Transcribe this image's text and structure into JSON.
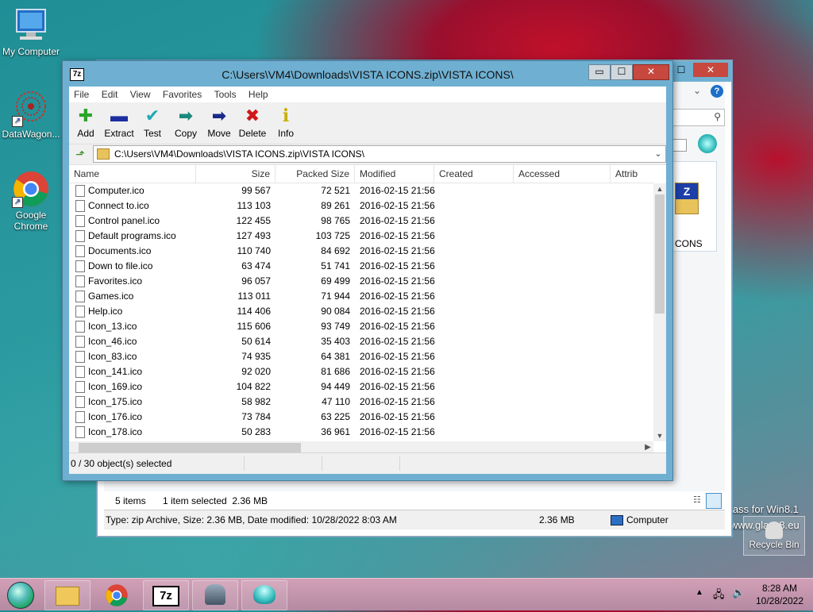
{
  "desktop": {
    "icons": [
      {
        "label": "My Computer"
      },
      {
        "label": "DataWagon..."
      },
      {
        "label": "Google Chrome"
      }
    ],
    "recycle_bin": "Recycle Bin",
    "watermark_line1": "lass for Win8.1",
    "watermark_line2": "www.glass8.eu"
  },
  "explorer": {
    "status_items": "5 items",
    "status_selected": "1 item selected  2.36 MB",
    "detail": "Type: zip Archive, Size: 2.36 MB, Date modified: 10/28/2022 8:03 AM",
    "detail_size": "2.36 MB",
    "detail_location": "Computer",
    "partial_icon_label": "CONS",
    "search_placeholder": "",
    "buttons": {
      "minimize": "—",
      "maximize": "☐",
      "close": "✕",
      "help": "?"
    }
  },
  "zip": {
    "title": "C:\\Users\\VM4\\Downloads\\VISTA ICONS.zip\\VISTA ICONS\\",
    "app_icon": "7z",
    "window_buttons": {
      "minimize": "▭",
      "maximize": "☐",
      "close": "✕"
    },
    "menu": [
      "File",
      "Edit",
      "View",
      "Favorites",
      "Tools",
      "Help"
    ],
    "toolbar": [
      {
        "label": "Add",
        "icon": "plus-icon",
        "glyph": "✚",
        "color": "#2aa52a"
      },
      {
        "label": "Extract",
        "icon": "minus-icon",
        "glyph": "▬",
        "color": "#1c2ea0"
      },
      {
        "label": "Test",
        "icon": "check-icon",
        "glyph": "✔",
        "color": "#22a9b3"
      },
      {
        "label": "Copy",
        "icon": "copy-arrow-icon",
        "glyph": "➡",
        "color": "#1b8a7a"
      },
      {
        "label": "Move",
        "icon": "move-arrow-icon",
        "glyph": "➡",
        "color": "#1a2a8a"
      },
      {
        "label": "Delete",
        "icon": "delete-x-icon",
        "glyph": "✖",
        "color": "#d01818"
      },
      {
        "label": "Info",
        "icon": "info-icon",
        "glyph": "i",
        "color": "#d8c000"
      }
    ],
    "address": "C:\\Users\\VM4\\Downloads\\VISTA ICONS.zip\\VISTA ICONS\\",
    "columns": [
      "Name",
      "Size",
      "Packed Size",
      "Modified",
      "Created",
      "Accessed",
      "Attrib"
    ],
    "files": [
      [
        "Computer.ico",
        "99 567",
        "72 521",
        "2016-02-15 21:56"
      ],
      [
        "Connect to.ico",
        "113 103",
        "89 261",
        "2016-02-15 21:56"
      ],
      [
        "Control panel.ico",
        "122 455",
        "98 765",
        "2016-02-15 21:56"
      ],
      [
        "Default programs.ico",
        "127 493",
        "103 725",
        "2016-02-15 21:56"
      ],
      [
        "Documents.ico",
        "110 740",
        "84 692",
        "2016-02-15 21:56"
      ],
      [
        "Down to file.ico",
        "63 474",
        "51 741",
        "2016-02-15 21:56"
      ],
      [
        "Favorites.ico",
        "96 057",
        "69 499",
        "2016-02-15 21:56"
      ],
      [
        "Games.ico",
        "113 011",
        "71 944",
        "2016-02-15 21:56"
      ],
      [
        "Help.ico",
        "114 406",
        "90 084",
        "2016-02-15 21:56"
      ],
      [
        "Icon_13.ico",
        "115 606",
        "93 749",
        "2016-02-15 21:56"
      ],
      [
        "Icon_46.ico",
        "50 614",
        "35 403",
        "2016-02-15 21:56"
      ],
      [
        "Icon_83.ico",
        "74 935",
        "64 381",
        "2016-02-15 21:56"
      ],
      [
        "Icon_141.ico",
        "92 020",
        "81 686",
        "2016-02-15 21:56"
      ],
      [
        "Icon_169.ico",
        "104 822",
        "94 449",
        "2016-02-15 21:56"
      ],
      [
        "Icon_175.ico",
        "58 982",
        "47 110",
        "2016-02-15 21:56"
      ],
      [
        "Icon_176.ico",
        "73 784",
        "63 225",
        "2016-02-15 21:56"
      ],
      [
        "Icon_178.ico",
        "50 283",
        "36 961",
        "2016-02-15 21:56"
      ]
    ],
    "status": "0 / 30 object(s) selected"
  },
  "taskbar": {
    "time": "8:28 AM",
    "date": "10/28/2022",
    "app_7z": "7z"
  }
}
